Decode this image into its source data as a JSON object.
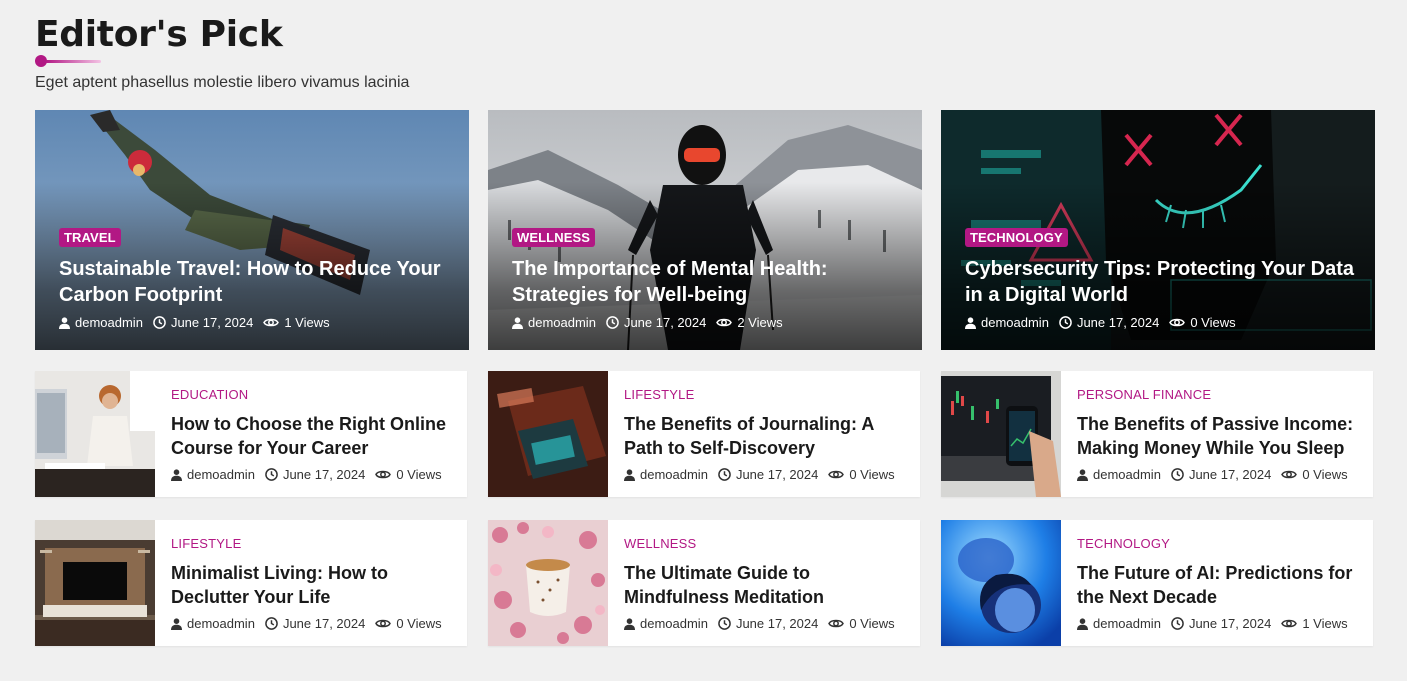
{
  "section": {
    "title": "Editor's Pick",
    "subtitle": "Eget aptent phasellus molestie libero vivamus lacinia"
  },
  "colors": {
    "accent": "#b21884",
    "background": "#f0f0f0"
  },
  "featured": [
    {
      "category": "TRAVEL",
      "title": "Sustainable Travel: How to Reduce Your Carbon Footprint",
      "author": "demoadmin",
      "date": "June 17, 2024",
      "views": "1 Views",
      "image": "snowboarder-jump-sky"
    },
    {
      "category": "WELLNESS",
      "title": "The Importance of Mental Health: Strategies for Well-being",
      "author": "demoadmin",
      "date": "June 17, 2024",
      "views": "2 Views",
      "image": "skier-snowy-mountains"
    },
    {
      "category": "TECHNOLOGY",
      "title": "Cybersecurity Tips: Protecting Your Data in a Digital World",
      "author": "demoadmin",
      "date": "June 17, 2024",
      "views": "0 Views",
      "image": "neon-mask-hacker"
    }
  ],
  "cards": [
    {
      "category": "EDUCATION",
      "title": "How to Choose the Right Online Course for Your Career",
      "author": "demoadmin",
      "date": "June 17, 2024",
      "views": "0 Views",
      "image": "woman-at-computer"
    },
    {
      "category": "LIFESTYLE",
      "title": "The Benefits of Journaling: A Path to Self-Discovery",
      "author": "demoadmin",
      "date": "June 17, 2024",
      "views": "0 Views",
      "image": "phone-on-table"
    },
    {
      "category": "PERSONAL FINANCE",
      "title": "The Benefits of Passive Income: Making Money While You Sleep",
      "author": "demoadmin",
      "date": "June 17, 2024",
      "views": "0 Views",
      "image": "stock-chart-phone"
    },
    {
      "category": "LIFESTYLE",
      "title": "Minimalist Living: How to Declutter Your Life",
      "author": "demoadmin",
      "date": "June 17, 2024",
      "views": "0 Views",
      "image": "minimalist-living-room"
    },
    {
      "category": "WELLNESS",
      "title": "The Ultimate Guide to Mindfulness Meditation",
      "author": "demoadmin",
      "date": "June 17, 2024",
      "views": "0 Views",
      "image": "tea-cup-blossoms"
    },
    {
      "category": "TECHNOLOGY",
      "title": "The Future of AI: Predictions for the Next Decade",
      "author": "demoadmin",
      "date": "June 17, 2024",
      "views": "1 Views",
      "image": "blue-light-faces"
    }
  ],
  "icons": {
    "author": "user-icon",
    "date": "clock-icon",
    "views": "eye-icon"
  }
}
